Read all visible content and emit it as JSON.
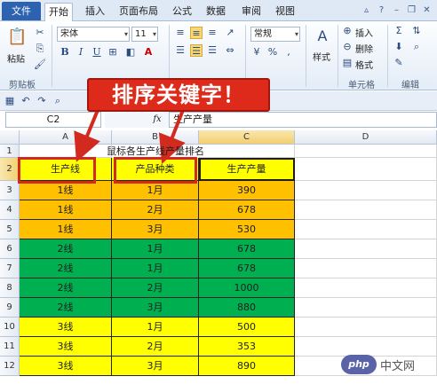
{
  "ribbon": {
    "tabs": [
      {
        "label": "文件",
        "active": false
      },
      {
        "label": "开始",
        "active": true
      },
      {
        "label": "插入",
        "active": false
      },
      {
        "label": "页面布局",
        "active": false
      },
      {
        "label": "公式",
        "active": false
      },
      {
        "label": "数据",
        "active": false
      },
      {
        "label": "审阅",
        "active": false
      },
      {
        "label": "视图",
        "active": false
      }
    ],
    "paste_label": "粘贴",
    "clipboard_label": "剪贴板",
    "font_name": "宋体",
    "font_size": "11",
    "number_format": "常规",
    "styles_label": "样式",
    "insert_label": "插入",
    "delete_label": "删除",
    "format_label": "格式",
    "cells_label": "单元格",
    "editing_label": "编辑",
    "number_pct": "%",
    "number_comma": ","
  },
  "formula_bar": {
    "name_box": "C2",
    "fx": "fx",
    "content": "生产产量"
  },
  "callout": "排序关键字！",
  "sheet": {
    "columns": [
      "A",
      "B",
      "C",
      "D"
    ],
    "title_row": "鼠标各生产线产量排名",
    "headers": [
      "生产线",
      "产品种类",
      "生产产量"
    ],
    "rows": [
      {
        "line": "1线",
        "month": "1月",
        "qty": "390",
        "color": "#ffc000"
      },
      {
        "line": "1线",
        "month": "2月",
        "qty": "678",
        "color": "#ffc000"
      },
      {
        "line": "1线",
        "month": "3月",
        "qty": "530",
        "color": "#ffc000"
      },
      {
        "line": "2线",
        "month": "1月",
        "qty": "678",
        "color": "#00b050"
      },
      {
        "line": "2线",
        "month": "1月",
        "qty": "678",
        "color": "#00b050"
      },
      {
        "line": "2线",
        "month": "2月",
        "qty": "1000",
        "color": "#00b050"
      },
      {
        "line": "2线",
        "month": "3月",
        "qty": "880",
        "color": "#00b050"
      },
      {
        "line": "3线",
        "month": "1月",
        "qty": "500",
        "color": "#ffff00"
      },
      {
        "line": "3线",
        "month": "2月",
        "qty": "353",
        "color": "#ffff00"
      },
      {
        "line": "3线",
        "month": "3月",
        "qty": "890",
        "color": "#ffff00"
      }
    ],
    "row_numbers": [
      "1",
      "2",
      "3",
      "4",
      "5",
      "6",
      "7",
      "8",
      "9",
      "10",
      "11",
      "12"
    ],
    "header_color": "#ffff00",
    "selected_cell": "C2"
  },
  "colors": {
    "callout": "#dd2a1b",
    "frame": "#d22a1e",
    "file_tab": "#2c62b0"
  },
  "watermark": {
    "logo": "php",
    "text": "中文网"
  }
}
